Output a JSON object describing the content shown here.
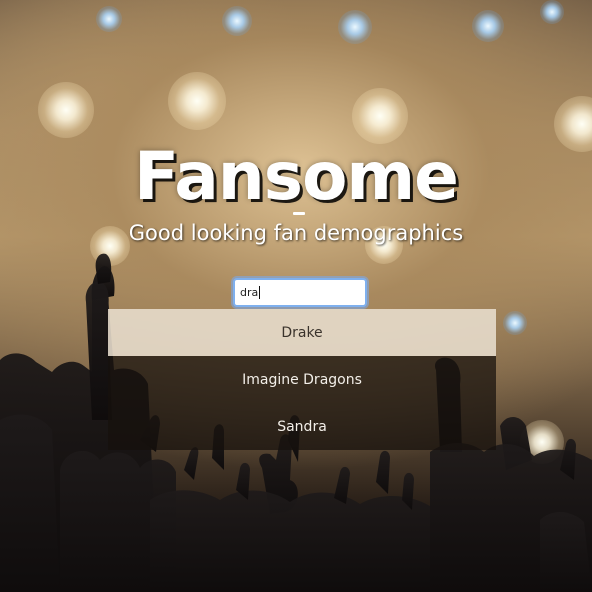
{
  "app": {
    "title": "Fansome",
    "tagline": "Good looking fan demographics"
  },
  "search": {
    "value": "dra",
    "placeholder": ""
  },
  "suggestions": {
    "items": [
      {
        "label": "Drake",
        "selected": true
      },
      {
        "label": "Imagine Dragons",
        "selected": false
      },
      {
        "label": "Sandra",
        "selected": false
      }
    ]
  },
  "colors": {
    "input_focus_ring": "#7fb0ee",
    "suggestion_active_bg": "#e8dece",
    "suggestion_inactive_bg": "#16100c"
  },
  "icons": {
    "text_caret": "text-caret-icon"
  }
}
